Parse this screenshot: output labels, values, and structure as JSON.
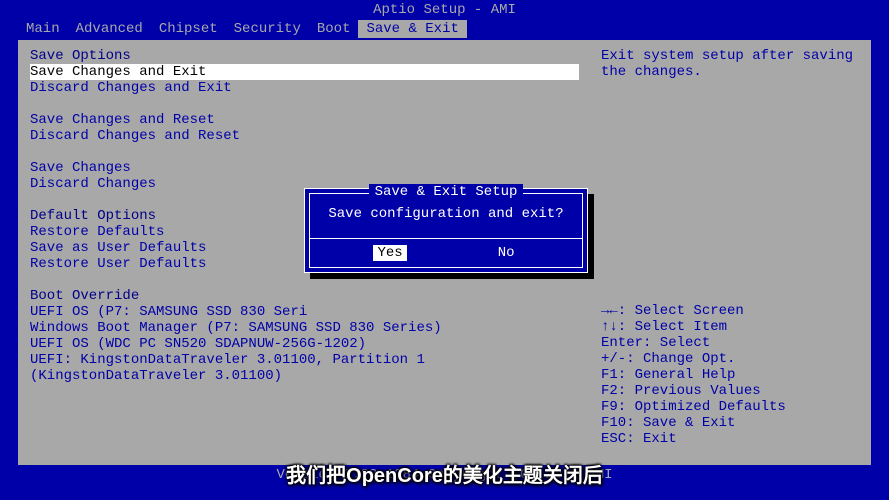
{
  "title": "Aptio Setup - AMI",
  "menu": {
    "items": [
      "Main",
      "Advanced",
      "Chipset",
      "Security",
      "Boot",
      "Save & Exit"
    ],
    "active_index": 5
  },
  "left_panel": {
    "sections": [
      {
        "header": "Save Options",
        "items": [
          {
            "label": "Save Changes and Exit",
            "selected": true
          },
          {
            "label": "Discard Changes and Exit"
          }
        ]
      },
      {
        "header": "",
        "items": [
          {
            "label": "Save Changes and Reset"
          },
          {
            "label": "Discard Changes and Reset"
          }
        ]
      },
      {
        "header": "",
        "items": [
          {
            "label": "Save Changes"
          },
          {
            "label": "Discard Changes"
          }
        ]
      },
      {
        "header": "Default Options",
        "items": [
          {
            "label": "Restore Defaults"
          },
          {
            "label": "Save as User Defaults"
          },
          {
            "label": "Restore User Defaults"
          }
        ]
      },
      {
        "header": "Boot Override",
        "items": [
          {
            "label": "UEFI OS (P7: SAMSUNG SSD 830 Seri"
          },
          {
            "label": "Windows Boot Manager (P7: SAMSUNG SSD 830 Series)"
          },
          {
            "label": "UEFI OS (WDC PC SN520 SDAPNUW-256G-1202)"
          },
          {
            "label": "UEFI: KingstonDataTraveler 3.01100, Partition 1"
          },
          {
            "label": "(KingstonDataTraveler 3.01100)"
          }
        ]
      }
    ]
  },
  "right_panel": {
    "help_text": "Exit system setup after saving the changes.",
    "key_hints": [
      "→←: Select Screen",
      "↑↓: Select Item",
      "Enter: Select",
      "+/-: Change Opt.",
      "F1: General Help",
      "F2: Previous Values",
      "F9: Optimized Defaults",
      "F10: Save & Exit",
      "ESC: Exit"
    ]
  },
  "dialog": {
    "title": "Save & Exit Setup",
    "message": "Save configuration and exit?",
    "buttons": {
      "yes": "Yes",
      "no": "No"
    }
  },
  "footer": "Version 2.22.1284 Copyright (C) 2022 AMI",
  "subtitle": "我们把OpenCore的美化主题关闭后"
}
